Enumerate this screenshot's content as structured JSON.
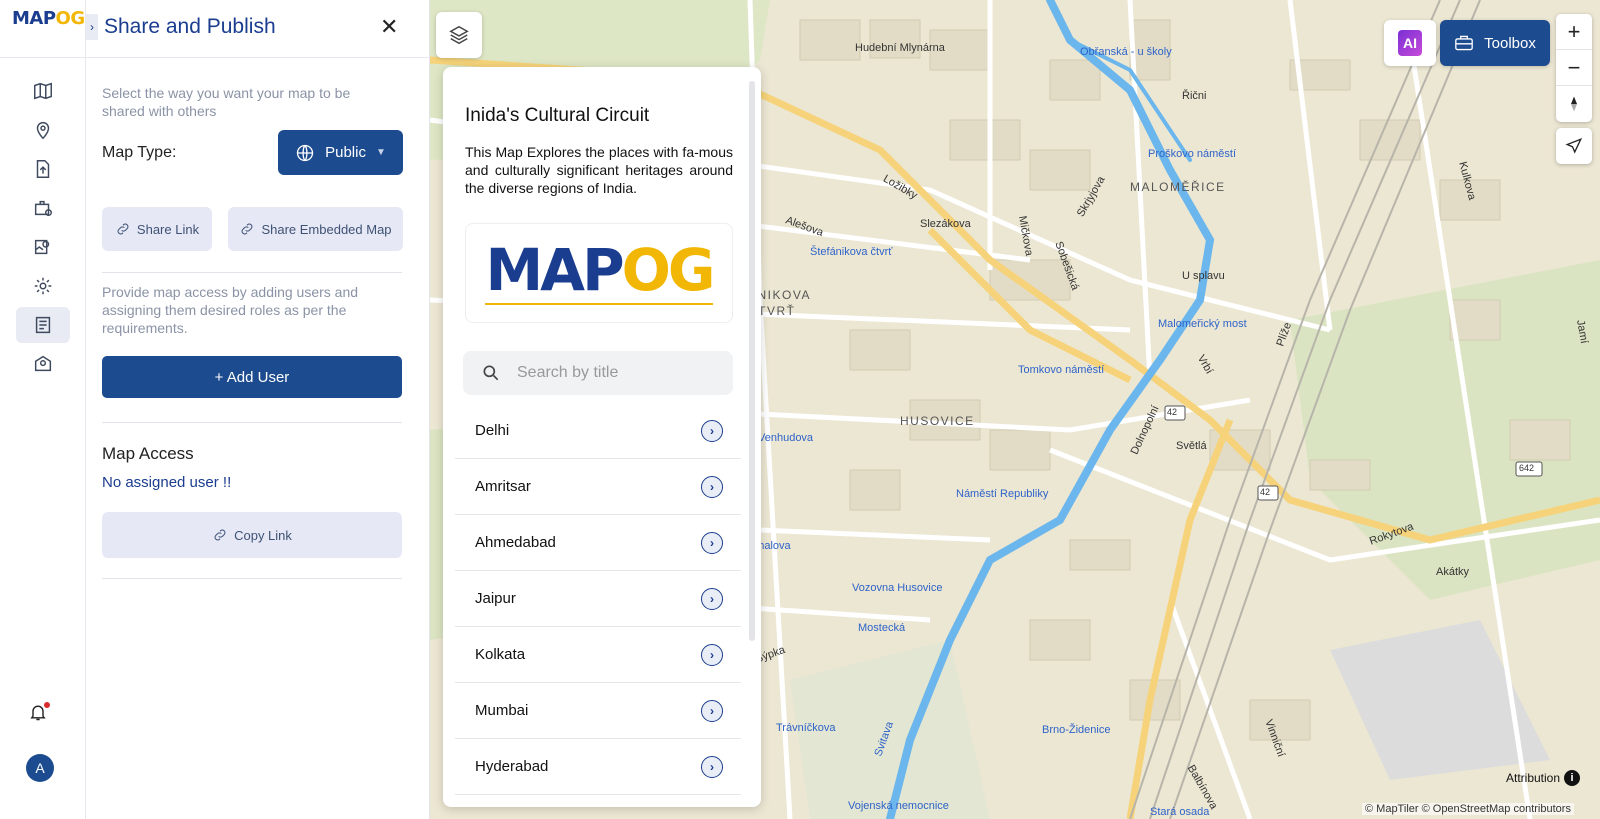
{
  "logo": {
    "text_main": "MAP",
    "text_accent": "OG"
  },
  "rail": {
    "icons": [
      "map-icon",
      "location-pin-icon",
      "upload-icon",
      "briefcase-settings-icon",
      "map-pin-edit-icon",
      "gear-icon",
      "share-list-icon",
      "map-chat-icon"
    ],
    "active": "share-list-icon",
    "avatar_letter": "A"
  },
  "panel": {
    "title": "Share and Publish",
    "intro": "Select the way you want your map to be shared with others",
    "map_type_label": "Map Type:",
    "map_type_value": "Public",
    "share_link_label": "Share Link",
    "share_embedded_label": "Share Embedded Map",
    "access_intro": "Provide map access by adding users and assigning them desired roles as per the requirements.",
    "add_user_label": "+ Add User",
    "map_access_title": "Map Access",
    "no_user_text": "No assigned user !!",
    "copy_link_label": "Copy Link"
  },
  "story": {
    "title": "Inida's Cultural Circuit",
    "description": "This Map Explores the places with fa-mous and culturally significant heritages around the diverse regions of India.",
    "logo_main": "MAP",
    "logo_accent": "OG",
    "search_placeholder": "Search by title",
    "cities": [
      "Delhi",
      "Amritsar",
      "Ahmedabad",
      "Jaipur",
      "Kolkata",
      "Mumbai",
      "Hyderabad"
    ]
  },
  "map": {
    "toolbox_label": "Toolbox",
    "ai_label": "AI",
    "attribution_label": "Attribution",
    "copyright": "© MapTiler © OpenStreetMap contributors",
    "places": [
      "Hudební Mlynárna",
      "Obřanská - u školy",
      "Řičnі",
      "Proškovo náměstí",
      "MALOMĚŘICE",
      "Kulkova",
      "Ložibky",
      "Skrjyjova",
      "Alešova",
      "Slezákova",
      "Mičkova",
      "Štefánikova čtvrť",
      "Sobešická",
      "U splavu",
      "ÁNIKOVA",
      "ČTVRŤ",
      "Malomeřický most",
      "Jamí",
      "Tomkovo náměstí",
      "Vrbí",
      "Plíže",
      "HUSOVICE",
      "Venhudova",
      "Dolnopolní",
      "Světlá",
      "Náměstí Republiky",
      "Rokytova",
      "ňáhalova",
      "Vozovna Husovice",
      "Akátky",
      "Mostecká",
      "Sýpka",
      "Trávníčkova",
      "Vinniční",
      "Brno-Židenice",
      "Balbínova",
      "Svitava",
      "Vojenská nemocnice",
      "Stará osada"
    ],
    "road_numbers": [
      "42",
      "42",
      "642"
    ]
  }
}
